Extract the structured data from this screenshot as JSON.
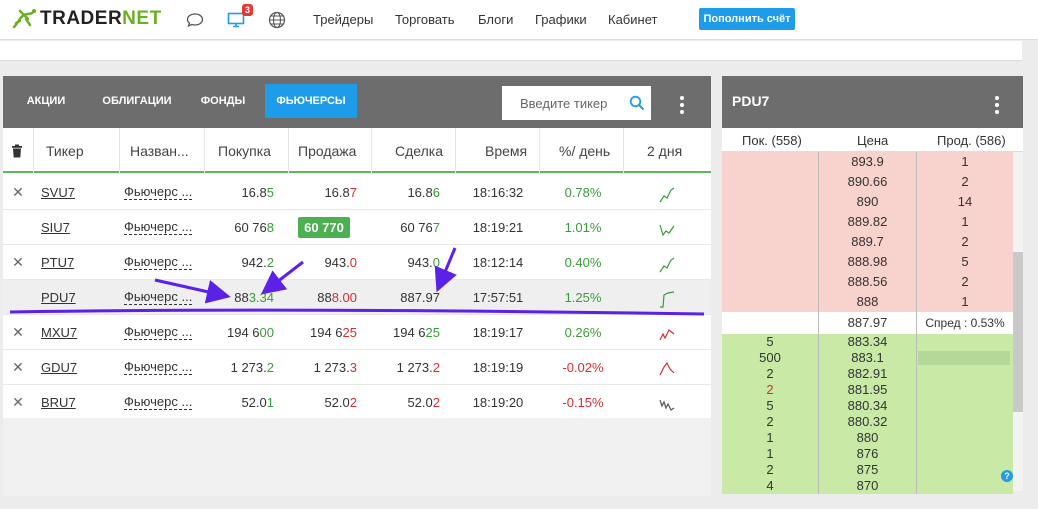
{
  "app": {
    "logo_text_a": "TRADER",
    "logo_text_b": "NET"
  },
  "topbar": {
    "notification_count": "3",
    "nav": [
      "Трейдеры",
      "Торговать",
      "Блоги",
      "Графики",
      "Кабинет"
    ],
    "topup_label": "Пополнить счёт"
  },
  "tabs": [
    "АКЦИИ",
    "ОБЛИГАЦИИ",
    "ФОНДЫ",
    "ФЬЮЧЕРСЫ"
  ],
  "active_tab": "ФЬЮЧЕРСЫ",
  "search": {
    "placeholder": "Введите тикер"
  },
  "table": {
    "columns": [
      "Тикер",
      "Назван...",
      "Покупка",
      "Продажа",
      "Сделка",
      "Время",
      "%/ день",
      "2 дня"
    ],
    "rows": [
      {
        "ticker": "SVU7",
        "name": "Фьючерс ...",
        "bid": [
          "16.8",
          "5"
        ],
        "ask": [
          "16.8",
          "7"
        ],
        "last": [
          "16.8",
          "6"
        ],
        "time": "18:16:32",
        "change": "0.78%",
        "trend": "up",
        "removable": true
      },
      {
        "ticker": "SIU7",
        "name": "Фьючерс ...",
        "bid": [
          "60 76",
          "8"
        ],
        "ask": [
          "60 770",
          ""
        ],
        "ask_highlight": true,
        "last": [
          "60 76",
          "7"
        ],
        "time": "18:19:21",
        "change": "1.01%",
        "trend": "down-up",
        "removable": false
      },
      {
        "ticker": "PTU7",
        "name": "Фьючерс ...",
        "bid": [
          "942.",
          "2"
        ],
        "ask": [
          "943.",
          "0"
        ],
        "last": [
          "943.",
          "0"
        ],
        "time": "18:12:14",
        "change": "0.40%",
        "trend": "up",
        "removable": true
      },
      {
        "ticker": "PDU7",
        "name": "Фьючерс ...",
        "bid": [
          "88",
          "3.34"
        ],
        "ask": [
          "88",
          "8.00"
        ],
        "last": [
          "887.97",
          ""
        ],
        "time": "17:57:51",
        "change": "1.25%",
        "trend": "step-up",
        "removable": false,
        "selected": true
      },
      {
        "ticker": "MXU7",
        "name": "Фьючерс ...",
        "bid": [
          "194 6",
          "00"
        ],
        "ask": [
          "194 6",
          "25"
        ],
        "last": [
          "194 6",
          "25"
        ],
        "time": "18:19:17",
        "change": "0.26%",
        "trend": "red-up",
        "removable": true
      },
      {
        "ticker": "GDU7",
        "name": "Фьючерс ...",
        "bid": [
          "1 273.",
          "2"
        ],
        "ask": [
          "1 273.",
          "3"
        ],
        "last": [
          "1 273.",
          "2"
        ],
        "time": "18:19:19",
        "change": "-0.02%",
        "trend": "red-hill",
        "removable": true
      },
      {
        "ticker": "BRU7",
        "name": "Фьючерс ...",
        "bid": [
          "52.0",
          "1"
        ],
        "ask": [
          "52.0",
          "2"
        ],
        "last": [
          "52.0",
          "2"
        ],
        "time": "18:19:20",
        "change": "-0.15%",
        "trend": "down",
        "removable": true
      }
    ]
  },
  "orderbook": {
    "title": "PDU7",
    "head_bid": "Пок. (558)",
    "head_price": "Цена",
    "head_ask": "Прод. (586)",
    "asks": [
      {
        "price": "893.9",
        "qty": "1"
      },
      {
        "price": "890.66",
        "qty": "2"
      },
      {
        "price": "890",
        "qty": "14"
      },
      {
        "price": "889.82",
        "qty": "1"
      },
      {
        "price": "889.7",
        "qty": "2"
      },
      {
        "price": "888.98",
        "qty": "5"
      },
      {
        "price": "888.56",
        "qty": "2"
      },
      {
        "price": "888",
        "qty": "1"
      }
    ],
    "last_price": "887.97",
    "spread_label": "Спред : 0.53%",
    "bids": [
      {
        "qty": "5",
        "price": "883.34"
      },
      {
        "qty": "500",
        "price": "883.1"
      },
      {
        "qty": "2",
        "price": "882.91"
      },
      {
        "qty": "2",
        "price": "881.95",
        "highlight": true
      },
      {
        "qty": "5",
        "price": "880.34"
      },
      {
        "qty": "2",
        "price": "880.32"
      },
      {
        "qty": "1",
        "price": "880"
      },
      {
        "qty": "1",
        "price": "876"
      },
      {
        "qty": "2",
        "price": "875"
      },
      {
        "qty": "4",
        "price": "870"
      }
    ]
  },
  "colors": {
    "accent": "#1e9be9",
    "positive": "#3a9b3a",
    "negative": "#d32f2f",
    "ask_bg": "#f8d2cc",
    "bid_bg": "#c8eaa6",
    "annotation": "#5b21e6",
    "header": "#6d6d6d"
  }
}
